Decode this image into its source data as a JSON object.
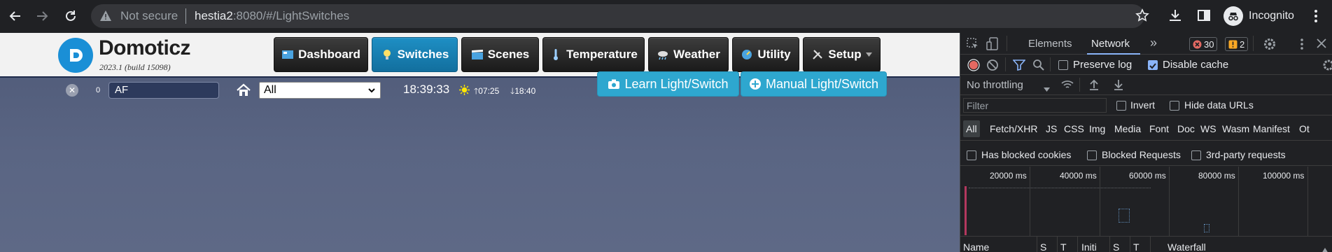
{
  "browser": {
    "security_label": "Not secure",
    "url_host": "hestia2",
    "url_rest": ":8080/#/LightSwitches",
    "profile_label": "Incognito",
    "icons": [
      "back-icon",
      "forward-icon",
      "reload-icon",
      "warning-icon",
      "star-icon",
      "download-icon",
      "sidepanel-icon",
      "incognito-icon",
      "menu-icon"
    ]
  },
  "app": {
    "brand": "Domoticz",
    "version": "2023.1 (build 15098)",
    "nav": [
      {
        "label": "Dashboard",
        "icon": "dashboard-icon",
        "active": false
      },
      {
        "label": "Switches",
        "icon": "bulb-icon",
        "active": true
      },
      {
        "label": "Scenes",
        "icon": "scenes-icon",
        "active": false
      },
      {
        "label": "Temperature",
        "icon": "thermometer-icon",
        "active": false
      },
      {
        "label": "Weather",
        "icon": "weather-icon",
        "active": false
      },
      {
        "label": "Utility",
        "icon": "utility-icon",
        "active": false
      },
      {
        "label": "Setup",
        "icon": "tools-icon",
        "active": false
      }
    ],
    "filter": {
      "count": "0",
      "search_value": "AF",
      "room_selected": "All"
    },
    "time": "18:39:33",
    "sunrise": "07:25",
    "sunset": "18:40",
    "actions": {
      "learn_label": "Learn Light/Switch",
      "manual_label": "Manual Light/Switch"
    },
    "colors": {
      "active_nav": "#1e8fc4",
      "action_button": "#2ea7cf",
      "background": "#5a6583"
    }
  },
  "devtools": {
    "tabs": [
      "Elements",
      "Network"
    ],
    "active_tab": "Network",
    "more": "»",
    "errors_count": "30",
    "warnings_count": "2",
    "preserve_log": "Preserve log",
    "disable_cache": "Disable cache",
    "throttling": "No throttling",
    "filter_placeholder": "Filter",
    "invert": "Invert",
    "hide_data_urls": "Hide data URLs",
    "types": [
      "All",
      "Fetch/XHR",
      "JS",
      "CSS",
      "Img",
      "Media",
      "Font",
      "Doc",
      "WS",
      "Wasm",
      "Manifest",
      "Ot"
    ],
    "blocked_cookies": "Has blocked cookies",
    "blocked_requests": "Blocked Requests",
    "third_party": "3rd-party requests",
    "timeline": [
      "20000 ms",
      "40000 ms",
      "60000 ms",
      "80000 ms",
      "100000 ms"
    ],
    "columns": [
      "Name",
      "S",
      "T",
      "Initi",
      "S",
      "T",
      "Waterfall"
    ]
  }
}
